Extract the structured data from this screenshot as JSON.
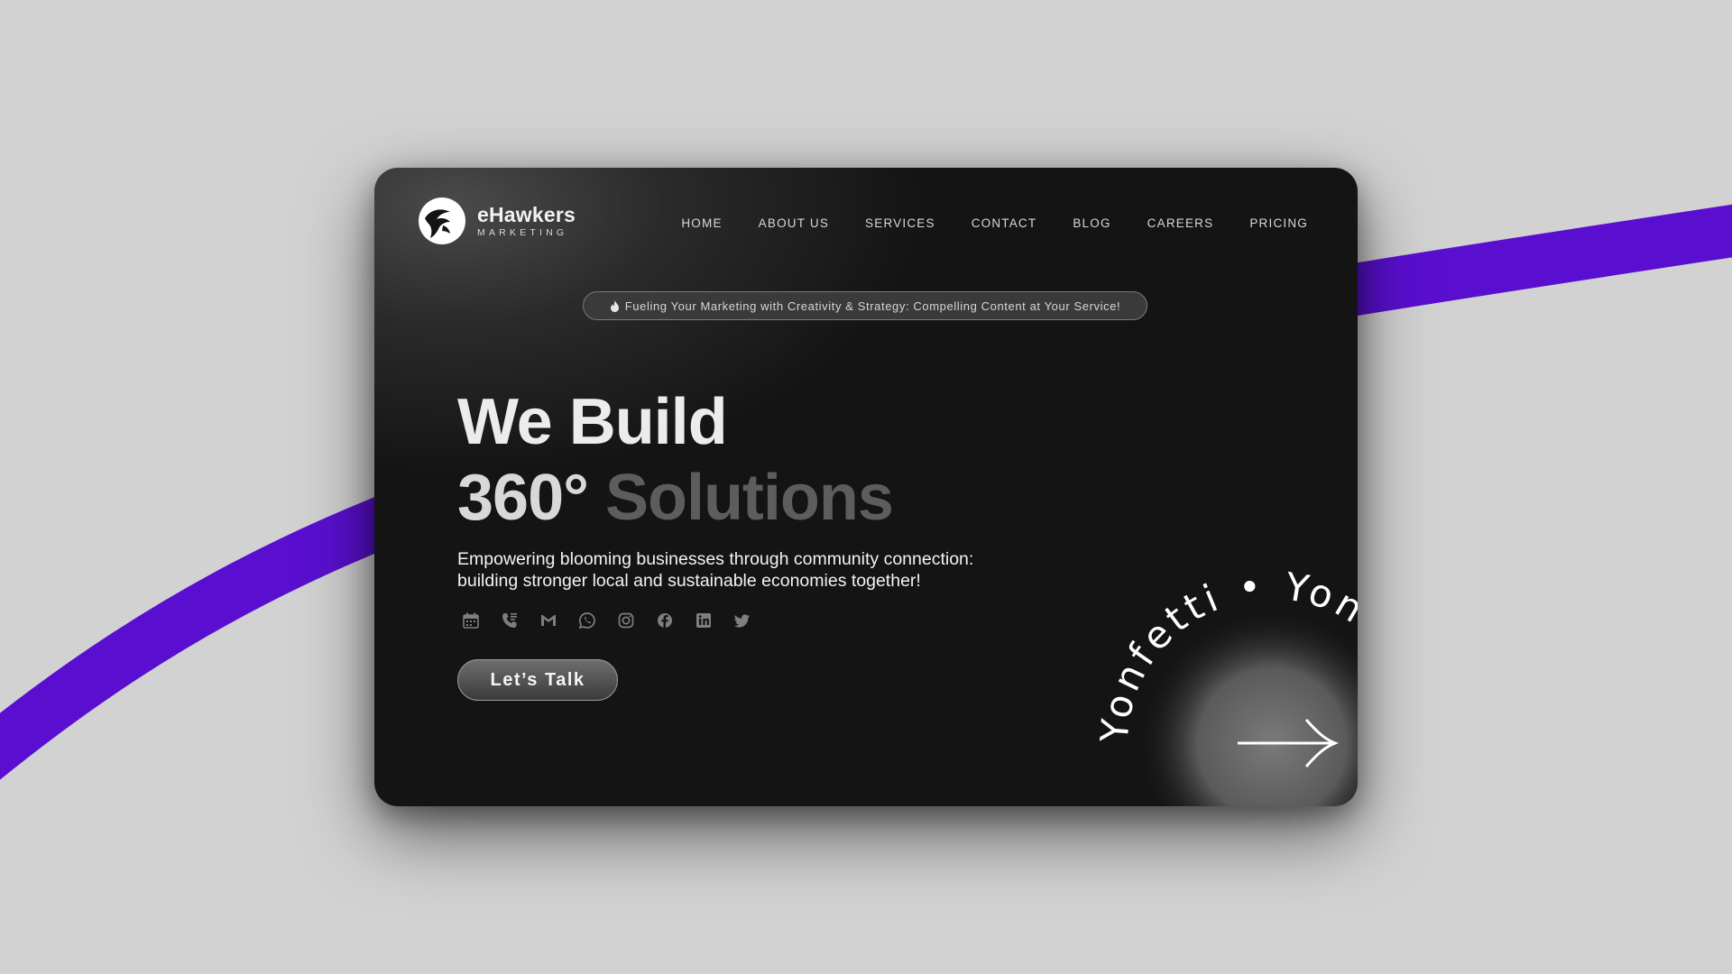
{
  "brand": {
    "name": "eHawkers",
    "tagline": "MARKETING",
    "logo_icon": "hawk-logo-icon"
  },
  "nav": {
    "items": [
      {
        "label": "HOME"
      },
      {
        "label": "ABOUT US"
      },
      {
        "label": "SERVICES"
      },
      {
        "label": "CONTACT"
      },
      {
        "label": "BLOG"
      },
      {
        "label": "CAREERS"
      },
      {
        "label": "PRICING"
      }
    ]
  },
  "announcement": {
    "icon": "flame-icon",
    "text": "Fueling Your Marketing with Creativity & Strategy: Compelling Content at Your Service!"
  },
  "hero": {
    "headline_line1": "We Build",
    "headline_line2_a": "360°",
    "headline_line2_b": "Solutions",
    "subtext_line1": "Empowering blooming businesses through community connection:",
    "subtext_line2": "building stronger local and sustainable economies together!",
    "cta_label": "Let’s Talk"
  },
  "social_icons": [
    "calendar-icon",
    "phone-icon",
    "gmail-icon",
    "whatsapp-icon",
    "instagram-icon",
    "facebook-icon",
    "linkedin-icon",
    "twitter-icon"
  ],
  "badge": {
    "circular_text": "Yonfetti • Yonfetti • Yonfetti • ",
    "icon": "arrow-right-icon"
  },
  "colors": {
    "page_bg": "#d2d2d2",
    "card_bg": "#141414",
    "ribbon": "#5a0fd0",
    "text_primary": "#ececec",
    "text_muted": "#5d5d5d"
  }
}
